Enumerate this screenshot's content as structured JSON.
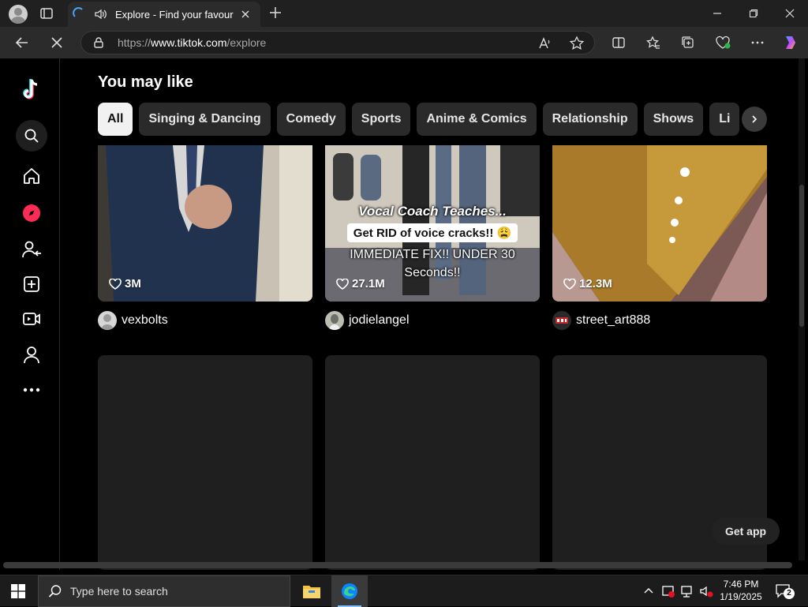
{
  "browser": {
    "tab_title": "Explore - Find your favourite",
    "new_tab_label": "+",
    "url_prefix": "https://",
    "url_host": "www.tiktok.com",
    "url_path": "/explore"
  },
  "main": {
    "heading": "You may like",
    "chips": [
      "All",
      "Singing & Dancing",
      "Comedy",
      "Sports",
      "Anime & Comics",
      "Relationship",
      "Shows",
      "Li"
    ]
  },
  "videos": [
    {
      "likes": "3M",
      "author": "vexbolts"
    },
    {
      "likes": "27.1M",
      "author": "jodielangel",
      "caption_1": "Vocal Coach Teaches...",
      "caption_2": "Get RID of voice cracks!! 😩",
      "caption_3": "IMMEDIATE FIX!! UNDER 30",
      "caption_4": "Seconds!!"
    },
    {
      "likes": "12.3M",
      "author": "street_art888"
    }
  ],
  "get_app_label": "Get app",
  "taskbar": {
    "search_placeholder": "Type here to search",
    "time": "7:46 PM",
    "date": "1/19/2025",
    "notification_count": "2"
  },
  "colors": {
    "accent": "#fe2c55",
    "background": "#000000",
    "chip_bg": "#2a2a2a",
    "edge_blue": "#0a84ff"
  }
}
